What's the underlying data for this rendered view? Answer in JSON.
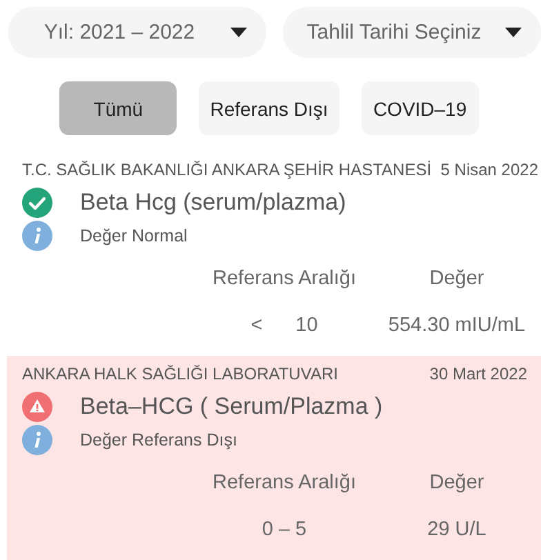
{
  "dropdowns": [
    {
      "value": "Yıl: 2021 – 2022"
    },
    {
      "value": "Tahlil Tarihi Seçiniz"
    }
  ],
  "filters": [
    {
      "label": "Tümü",
      "selected": true
    },
    {
      "label": "Referans Dışı",
      "selected": false
    },
    {
      "label": "COVID–19",
      "selected": false
    }
  ],
  "results": [
    {
      "kind": "normal",
      "institution": "T.C. SAĞLIK BAKANLIĞI ANKARA ŞEHİR HASTANESİ",
      "date": "5 Nisan 2022",
      "test": "Beta Hcg (serum/plazma)",
      "status": "Değer Normal",
      "reference_header": "Referans Aralığı",
      "value_header": "Değer",
      "reference_operator": "<",
      "reference": "10",
      "value": "554.30 mIU/mL"
    },
    {
      "kind": "out_of_range",
      "institution": "ANKARA HALK SAĞLIĞI LABORATUVARI",
      "date": "30 Mart 2022",
      "test": "Beta–HCG ( Serum/Plazma )",
      "status": "Değer Referans Dışı",
      "reference_header": "Referans Aralığı",
      "value_header": "Değer",
      "reference": "0 – 5",
      "value": "29 U/L"
    }
  ]
}
